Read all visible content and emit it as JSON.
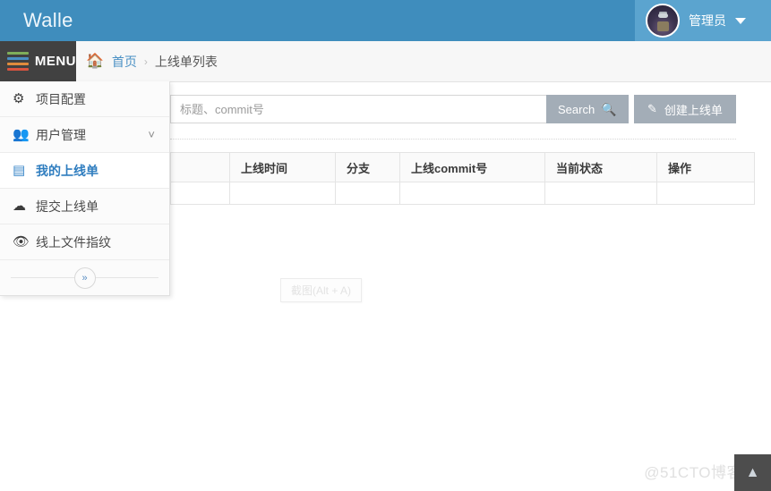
{
  "header": {
    "brand": "Walle",
    "user": {
      "name": "管理员",
      "avatar_icon": "walle-avatar",
      "caret_icon": "caret-down-icon"
    }
  },
  "subbar": {
    "menu_label": "MENU",
    "menu_icon": "hamburger-icon",
    "breadcrumb": {
      "home_icon": "home-icon",
      "items": [
        {
          "label": "首页",
          "link": true
        },
        {
          "label": "上线单列表",
          "link": false
        }
      ],
      "separator": "›"
    }
  },
  "sidebar": {
    "items": [
      {
        "label": "项目配置",
        "icon": "cogs-icon",
        "active": false,
        "has_caret": false
      },
      {
        "label": "用户管理",
        "icon": "users-icon",
        "active": false,
        "has_caret": true,
        "caret_icon": "chevron-down-icon"
      },
      {
        "label": "我的上线单",
        "icon": "list-alt-icon",
        "active": true,
        "has_caret": false
      },
      {
        "label": "提交上线单",
        "icon": "cloud-upload-icon",
        "active": false,
        "has_caret": false
      },
      {
        "label": "线上文件指纹",
        "icon": "eye-icon",
        "active": false,
        "has_caret": false
      }
    ],
    "collapse_toggle_icon": "chevron-double-right-icon",
    "collapse_toggle_label": "»"
  },
  "toolbar": {
    "search_placeholder": "标题、commit号",
    "search_value": "",
    "search_button_label": "Search",
    "search_button_icon": "magnifier-icon",
    "create_button_label": "创建上线单",
    "create_button_icon": "pencil-icon"
  },
  "table": {
    "columns": [
      "",
      "上线时间",
      "分支",
      "上线commit号",
      "当前状态",
      "操作"
    ],
    "rows": []
  },
  "overlays": {
    "screenshot_hint": "截图(Alt + A)",
    "watermark": "@51CTO博客",
    "back_to_top_icon": "chevron-up-icon",
    "back_to_top_label": "▲"
  },
  "colors": {
    "brand_header": "#3f8dbd",
    "user_box": "#5ba4cf",
    "menu_toggle": "#414141",
    "button_gray": "#a3adb7",
    "link_blue": "#4a90c4",
    "active_blue": "#2f7dbf"
  }
}
